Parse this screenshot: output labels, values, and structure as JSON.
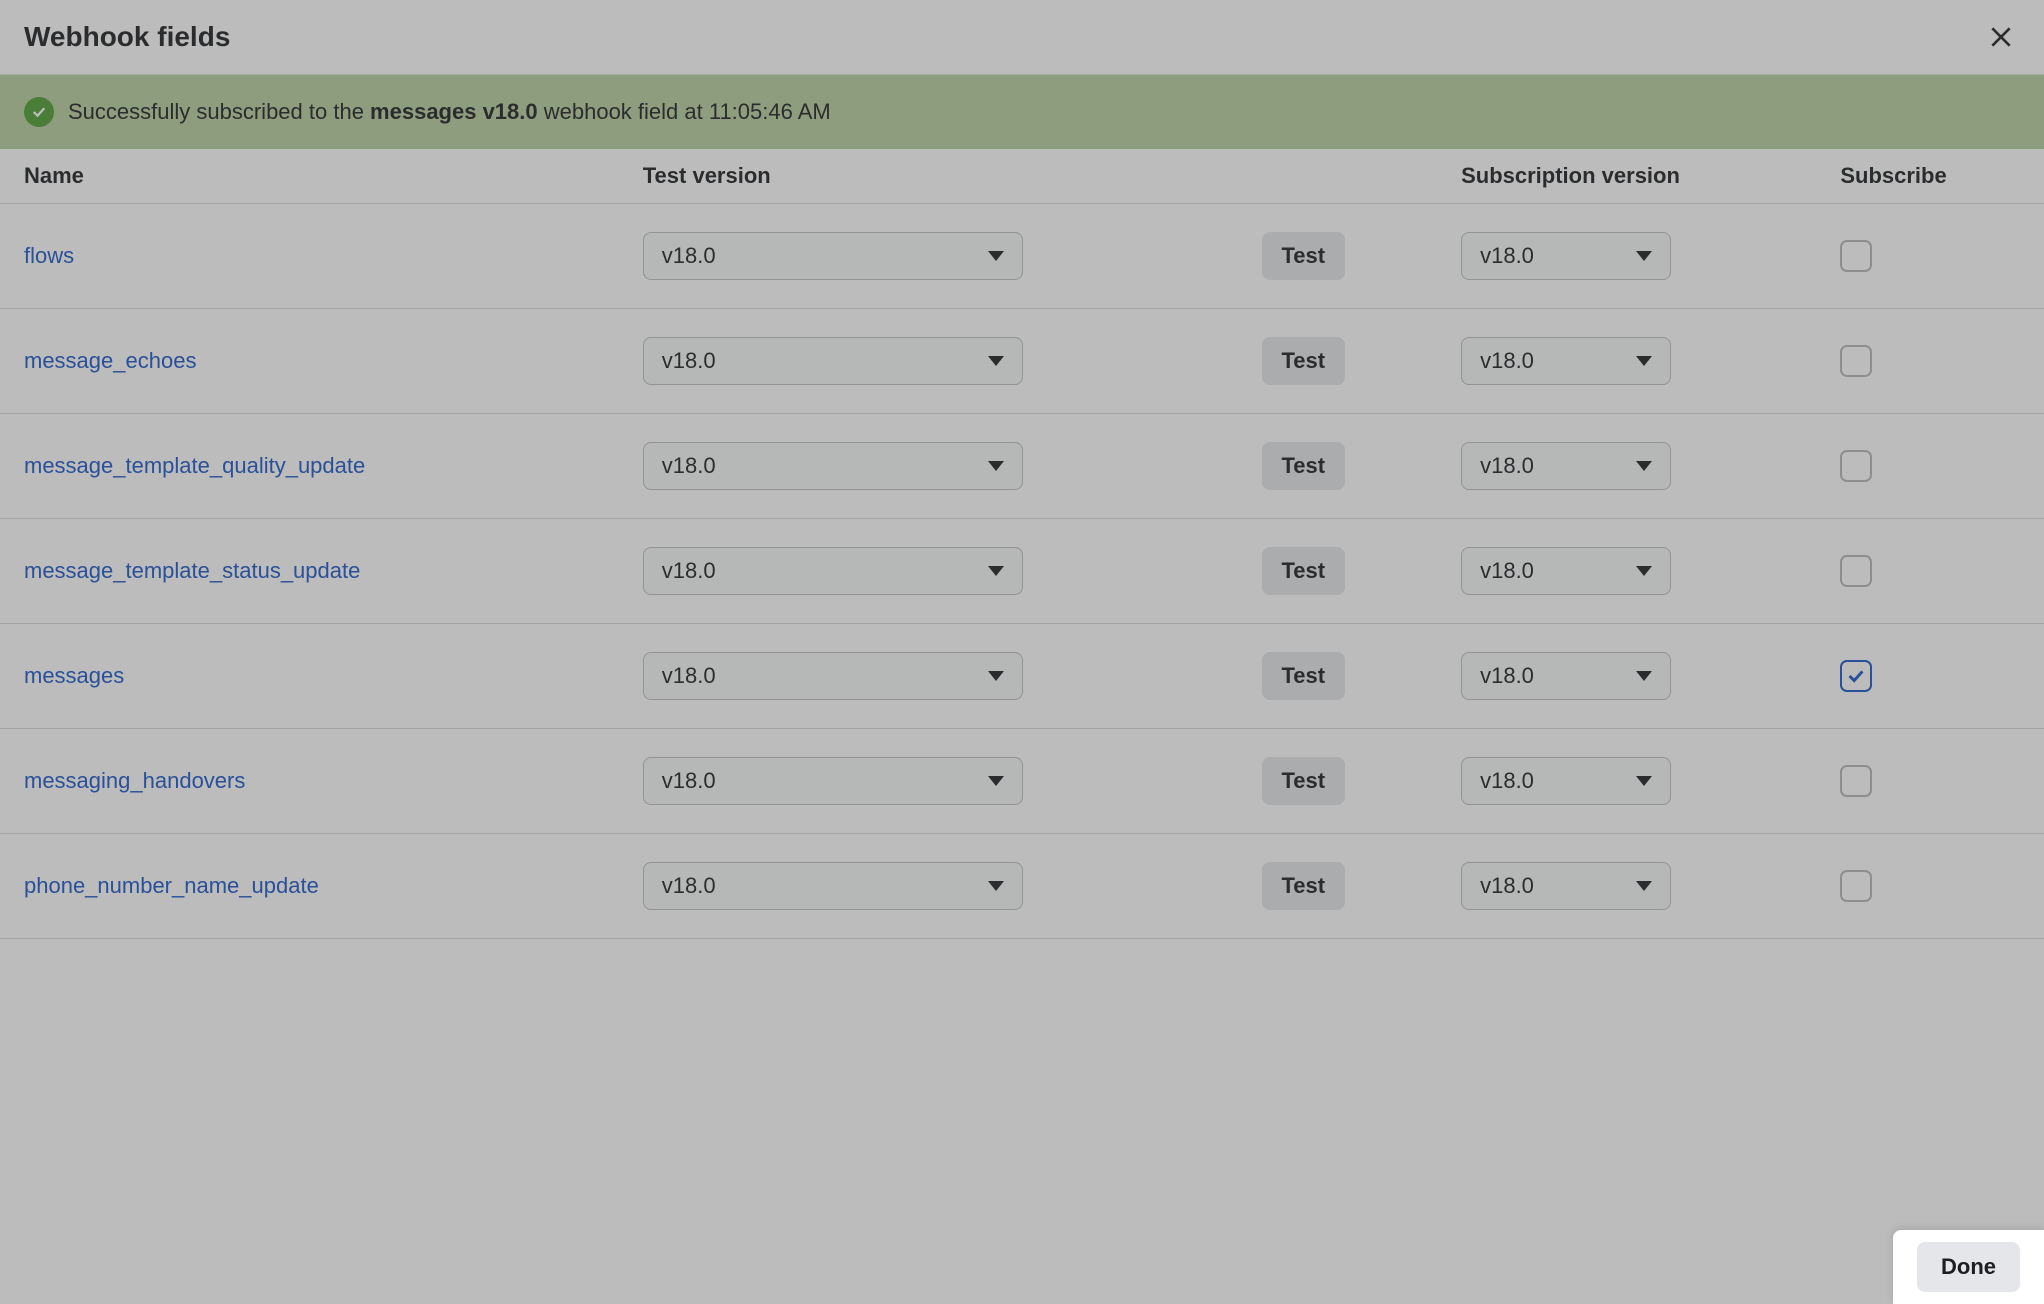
{
  "modal": {
    "title": "Webhook fields"
  },
  "toast": {
    "prefix": "Successfully subscribed to the ",
    "bold": "messages v18.0",
    "suffix": " webhook field at 11:05:46 AM"
  },
  "table": {
    "headers": {
      "name": "Name",
      "test_version": "Test version",
      "subscription_version": "Subscription version",
      "subscribe": "Subscribe"
    },
    "test_button_label": "Test",
    "rows": [
      {
        "name": "flows",
        "test_version": "v18.0",
        "sub_version": "v18.0",
        "subscribed": false
      },
      {
        "name": "message_echoes",
        "test_version": "v18.0",
        "sub_version": "v18.0",
        "subscribed": false
      },
      {
        "name": "message_template_quality_update",
        "test_version": "v18.0",
        "sub_version": "v18.0",
        "subscribed": false
      },
      {
        "name": "message_template_status_update",
        "test_version": "v18.0",
        "sub_version": "v18.0",
        "subscribed": false
      },
      {
        "name": "messages",
        "test_version": "v18.0",
        "sub_version": "v18.0",
        "subscribed": true
      },
      {
        "name": "messaging_handovers",
        "test_version": "v18.0",
        "sub_version": "v18.0",
        "subscribed": false
      },
      {
        "name": "phone_number_name_update",
        "test_version": "v18.0",
        "sub_version": "v18.0",
        "subscribed": false
      }
    ]
  },
  "footer": {
    "done_label": "Done"
  }
}
